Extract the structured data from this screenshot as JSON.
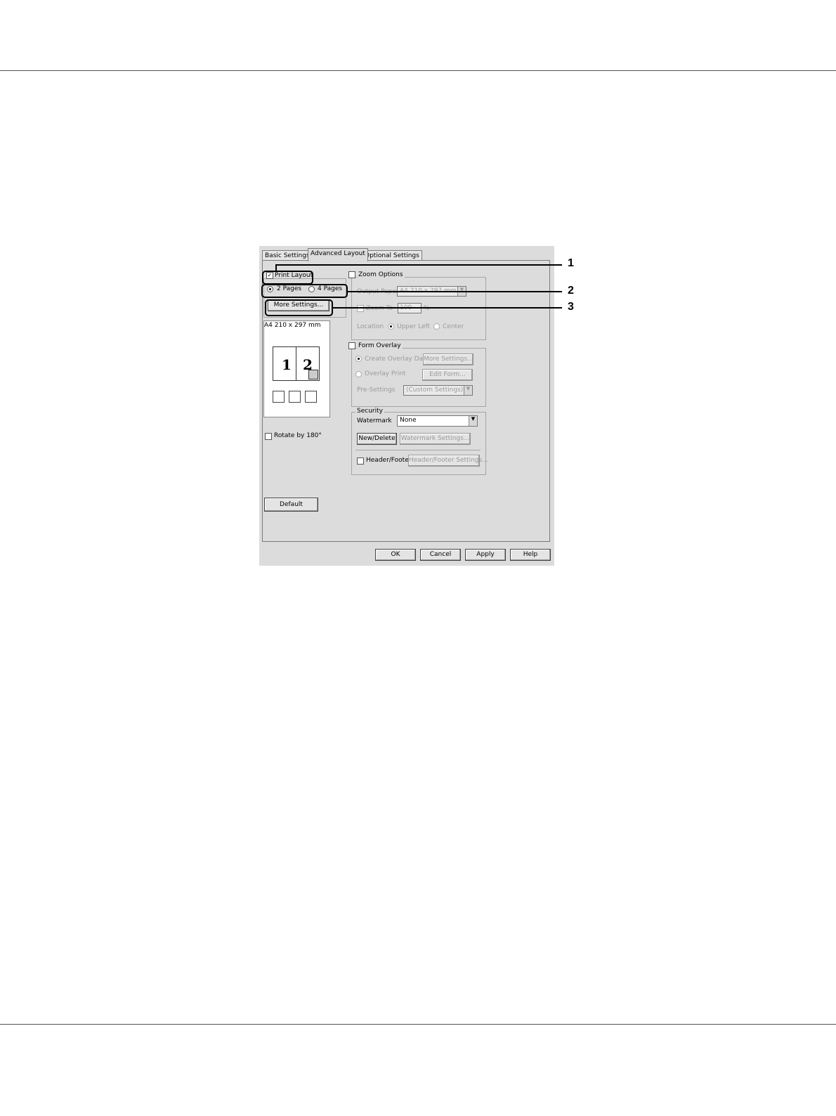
{
  "tabs": [
    "Basic Settings",
    "Advanced Layout",
    "Optional Settings"
  ],
  "print_layout": {
    "label": "Print Layout",
    "checked": true,
    "option_2pages": "2 Pages",
    "option_4pages": "4 Pages",
    "more_settings": "More Settings..."
  },
  "preview": {
    "paper_label": "A4 210 x 297 mm",
    "page1": "1",
    "page2": "2"
  },
  "rotate_label": "Rotate by 180°",
  "default_button": "Default",
  "zoom": {
    "label": "Zoom Options",
    "output_paper_label": "Output Paper",
    "output_paper_value": "A4 210 x 297 mm",
    "zoom_to_label": "Zoom To",
    "zoom_value": "100",
    "zoom_unit": "%",
    "location_label": "Location",
    "upper_left": "Upper Left",
    "center": "Center"
  },
  "form_overlay": {
    "label": "Form Overlay",
    "create_overlay": "Create Overlay Data",
    "more_settings": "More Settings...",
    "overlay_print": "Overlay Print",
    "edit_form": "Edit Form...",
    "pre_settings_label": "Pre-Settings",
    "pre_settings_value": "(Custom Settings)"
  },
  "security": {
    "label": "Security",
    "watermark_label": "Watermark",
    "watermark_value": "None",
    "new_delete": "New/Delete",
    "watermark_settings": "Watermark Settings...",
    "header_footer": "Header/Footer",
    "header_footer_settings": "Header/Footer Settings..."
  },
  "footer_buttons": {
    "ok": "OK",
    "cancel": "Cancel",
    "apply": "Apply",
    "help": "Help"
  },
  "callouts": [
    "1",
    "2",
    "3"
  ]
}
